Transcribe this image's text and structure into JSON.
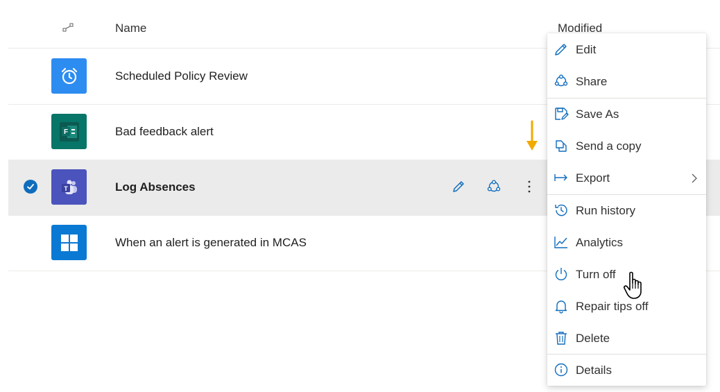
{
  "colors": {
    "accent": "#0f6cbd",
    "selected_row_bg": "#ebebeb",
    "arrow": "#f2a900"
  },
  "table": {
    "header": {
      "type_icon": "connector-type-icon",
      "name_label": "Name",
      "modified_label": "Modified"
    },
    "rows": [
      {
        "name": "Scheduled Policy Review",
        "icon": "alarm-clock-icon",
        "icon_bg": "#2d8cf0",
        "selected": false
      },
      {
        "name": "Bad feedback alert",
        "icon": "forms-icon",
        "icon_bg": "#077568",
        "selected": false
      },
      {
        "name": "Log Absences",
        "icon": "teams-icon",
        "icon_bg": "#4b53bc",
        "selected": true
      },
      {
        "name": "When an alert is generated in MCAS",
        "icon": "windows-icon",
        "icon_bg": "#0a79d4",
        "selected": false
      }
    ]
  },
  "context_menu": {
    "items": [
      {
        "label": "Edit",
        "icon": "pencil-icon"
      },
      {
        "label": "Share",
        "icon": "share-icon"
      },
      {
        "label": "Save As",
        "icon": "save-as-icon"
      },
      {
        "label": "Send a copy",
        "icon": "copy-icon"
      },
      {
        "label": "Export",
        "icon": "export-icon",
        "has_submenu": true
      },
      {
        "label": "Run history",
        "icon": "history-icon"
      },
      {
        "label": "Analytics",
        "icon": "analytics-icon"
      },
      {
        "label": "Turn off",
        "icon": "power-icon"
      },
      {
        "label": "Repair tips off",
        "icon": "bell-icon"
      },
      {
        "label": "Delete",
        "icon": "trash-icon"
      },
      {
        "label": "Details",
        "icon": "info-icon"
      }
    ]
  }
}
